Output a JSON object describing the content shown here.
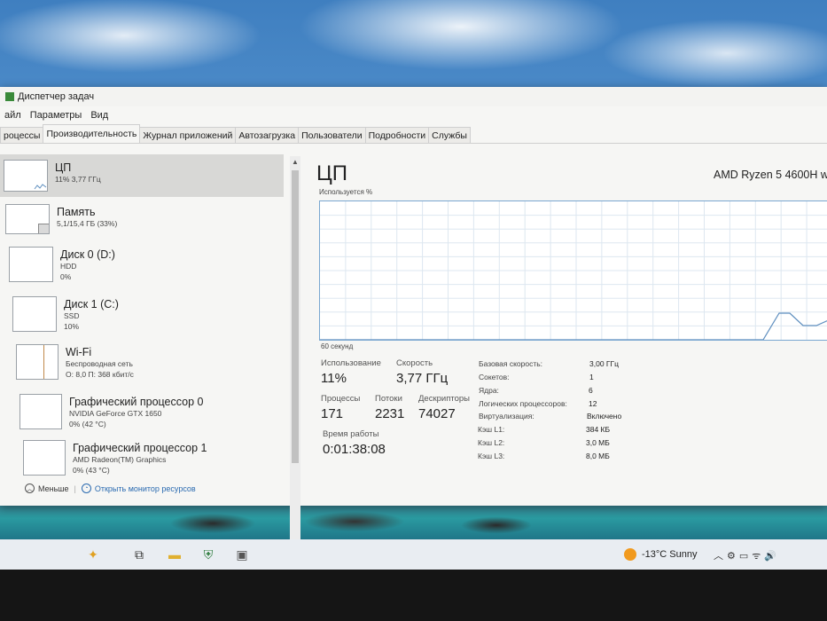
{
  "window": {
    "title": "Диспетчер задач"
  },
  "menu": [
    "айл",
    "Параметры",
    "Вид"
  ],
  "tabs": [
    "роцессы",
    "Производительность",
    "Журнал приложений",
    "Автозагрузка",
    "Пользователи",
    "Подробности",
    "Службы"
  ],
  "sidebar": {
    "items": [
      {
        "name": "ЦП",
        "line1": "11% 3,77 ГГц",
        "line2": "",
        "line3": ""
      },
      {
        "name": "Память",
        "line1": "5,1/15,4 ГБ (33%)",
        "line2": "",
        "line3": ""
      },
      {
        "name": "Диск 0 (D:)",
        "line1": "HDD",
        "line2": "0%",
        "line3": ""
      },
      {
        "name": "Диск 1 (C:)",
        "line1": "SSD",
        "line2": "10%",
        "line3": ""
      },
      {
        "name": "Wi-Fi",
        "line1": "Беспроводная сеть",
        "line2": "О: 8,0 П: 368 кбит/с",
        "line3": ""
      },
      {
        "name": "Графический процессор 0",
        "line1": "NVIDIA GeForce GTX 1650",
        "line2": "0% (42 °C)",
        "line3": ""
      },
      {
        "name": "Графический процессор 1",
        "line1": "AMD Radeon(TM) Graphics",
        "line2": "0% (43 °C)",
        "line3": ""
      }
    ]
  },
  "footer": {
    "less": "Меньше",
    "monitor": "Открыть монитор ресурсов"
  },
  "cpu": {
    "title": "ЦП",
    "model": "AMD Ryzen 5 4600H w",
    "graph_label": "Используется %",
    "graph_time": "60 секунд",
    "usage_label": "Использование",
    "usage_value": "11%",
    "speed_label": "Скорость",
    "speed_value": "3,77 ГГц",
    "processes_label": "Процессы",
    "processes_value": "171",
    "threads_label": "Потоки",
    "threads_value": "2231",
    "handles_label": "Дескрипторы",
    "handles_value": "74027",
    "uptime_label": "Время работы",
    "uptime_value": "0:01:38:08",
    "details": [
      {
        "key": "Базовая скорость:",
        "value": "3,00 ГГц"
      },
      {
        "key": "Сокетов:",
        "value": "1"
      },
      {
        "key": "Ядра:",
        "value": "6"
      },
      {
        "key": "Логических процессоров:",
        "value": "12"
      },
      {
        "key": "Виртуализация:",
        "value": "Включено"
      },
      {
        "key": "Кэш L1:",
        "value": "384 КБ"
      },
      {
        "key": "Кэш L2:",
        "value": "3,0 МБ"
      },
      {
        "key": "Кэш L3:",
        "value": "8,0 МБ"
      }
    ]
  },
  "taskbar": {
    "weather": "-13°C  Sunny"
  },
  "colors": {
    "graph_line": "#5f8fbf",
    "graph_grid": "#dde7f0",
    "accent_link": "#2a6ab0"
  }
}
